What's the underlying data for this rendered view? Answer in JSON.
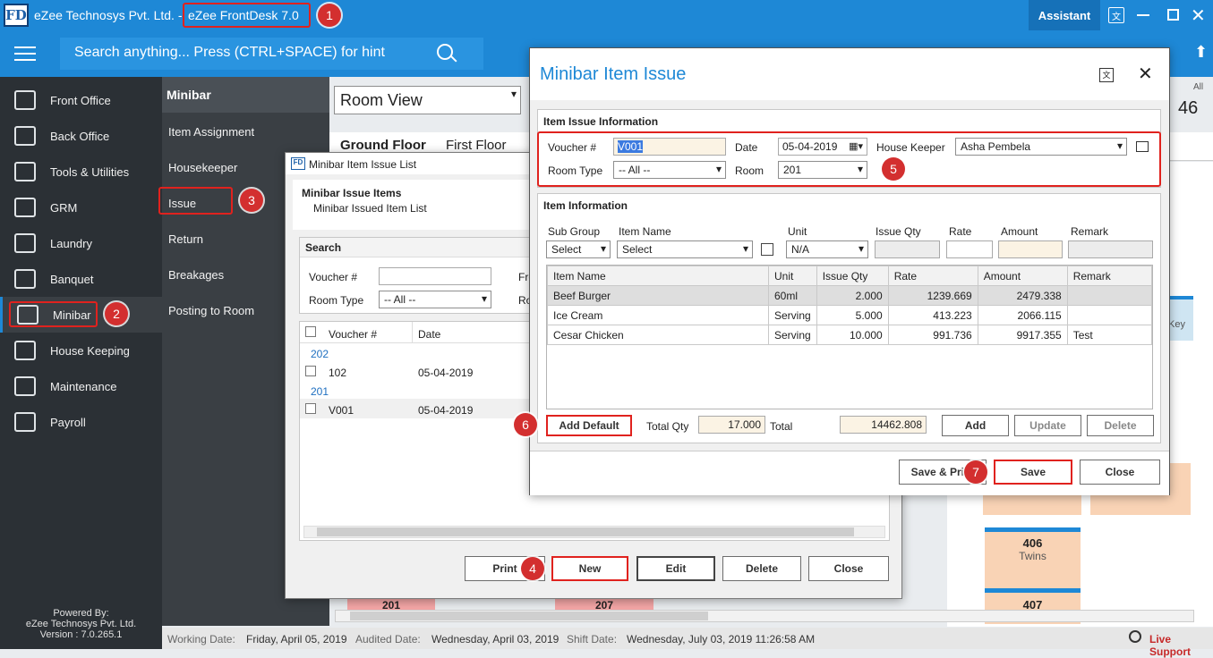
{
  "app": {
    "title_prefix": "eZee Technosys Pvt. Ltd. - ",
    "title_product": "eZee FrontDesk 7.0",
    "logo_text": "FD",
    "assistant_label": "Assistant",
    "search_placeholder": "Search anything... Press (CTRL+SPACE) for hint"
  },
  "sidebar": {
    "items": [
      {
        "label": "Front Office",
        "icon": "bell-icon"
      },
      {
        "label": "Back Office",
        "icon": "building-icon"
      },
      {
        "label": "Tools & Utilities",
        "icon": "tools-icon"
      },
      {
        "label": "GRM",
        "icon": "grm-icon"
      },
      {
        "label": "Laundry",
        "icon": "iron-icon"
      },
      {
        "label": "Banquet",
        "icon": "banquet-icon"
      },
      {
        "label": "Minibar",
        "icon": "fridge-icon"
      },
      {
        "label": "House Keeping",
        "icon": "housekeeping-icon"
      },
      {
        "label": "Maintenance",
        "icon": "maintenance-icon"
      },
      {
        "label": "Payroll",
        "icon": "payroll-icon"
      }
    ],
    "footer_line1": "Powered By:",
    "footer_line2": "eZee Technosys Pvt. Ltd.",
    "footer_line3": "Version : 7.0.265.1"
  },
  "subpanel": {
    "title": "Minibar",
    "items": [
      "Item Assignment",
      "Housekeeper",
      "Issue",
      "Return",
      "Breakages",
      "Posting to Room"
    ]
  },
  "room_view": {
    "dropdown": "Room View",
    "tab_ground": "Ground Floor",
    "tab_first": "First Floor",
    "count_label": "All",
    "count": "46",
    "room_406_no": "406",
    "room_406_type": "Twins",
    "room_407": "407",
    "room_201": "201",
    "room_207": "207",
    "key_text": "Key"
  },
  "issue_list": {
    "window_title": "Minibar Item Issue List",
    "header_title": "Minibar Issue Items",
    "header_sub": "Minibar Issued Item List",
    "search_title": "Search",
    "voucher_label": "Voucher #",
    "room_type_label": "Room Type",
    "room_type_value": "-- All --",
    "from_label": "Fro",
    "ro_label": "Ro",
    "col_voucher": "Voucher #",
    "col_date": "Date",
    "groups": [
      {
        "room": "202",
        "voucher": "102",
        "date": "05-04-2019"
      },
      {
        "room": "201",
        "voucher": "V001",
        "date": "05-04-2019"
      }
    ],
    "buttons": {
      "print": "Print",
      "new": "New",
      "edit": "Edit",
      "delete": "Delete",
      "close": "Close"
    }
  },
  "issue_dialog": {
    "title": "Minibar Item Issue",
    "section_info": "Item Issue Information",
    "voucher_label": "Voucher #",
    "voucher_value": "V001",
    "date_label": "Date",
    "date_value": "05-04-2019",
    "housekeeper_label": "House Keeper",
    "housekeeper_value": "Asha Pembela",
    "room_type_label": "Room Type",
    "room_type_value": "-- All --",
    "room_label": "Room",
    "room_value": "201",
    "section_items": "Item Information",
    "subgroup_label": "Sub Group",
    "subgroup_value": "Select",
    "itemname_label": "Item Name",
    "itemname_value": "Select",
    "unit_label": "Unit",
    "unit_value": "N/A",
    "issueqty_label": "Issue Qty",
    "rate_label": "Rate",
    "amount_label": "Amount",
    "remark_label": "Remark",
    "columns": [
      "Item Name",
      "Unit",
      "Issue Qty",
      "Rate",
      "Amount",
      "Remark"
    ],
    "rows": [
      {
        "item": "Beef Burger",
        "unit": "60ml",
        "qty": "2.000",
        "rate": "1239.669",
        "amount": "2479.338",
        "remark": ""
      },
      {
        "item": "Ice Cream",
        "unit": "Serving",
        "qty": "5.000",
        "rate": "413.223",
        "amount": "2066.115",
        "remark": ""
      },
      {
        "item": "Cesar Chicken",
        "unit": "Serving",
        "qty": "10.000",
        "rate": "991.736",
        "amount": "9917.355",
        "remark": "Test"
      }
    ],
    "add_default": "Add Default",
    "total_qty_label": "Total Qty",
    "total_qty_value": "17.000",
    "total_label": "Total",
    "total_value": "14462.808",
    "add": "Add",
    "update": "Update",
    "delete": "Delete",
    "save_print": "Save & Print",
    "save": "Save",
    "close": "Close"
  },
  "status": {
    "working_label": "Working Date:",
    "working_value": "Friday, April 05, 2019",
    "audited_label": "Audited Date:",
    "audited_value": "Wednesday, April 03, 2019",
    "shift_label": "Shift Date:",
    "shift_value": "Wednesday, July 03, 2019 11:26:58 AM",
    "live_support": "Live Support"
  },
  "markers": [
    "1",
    "2",
    "3",
    "4",
    "5",
    "6",
    "7"
  ]
}
